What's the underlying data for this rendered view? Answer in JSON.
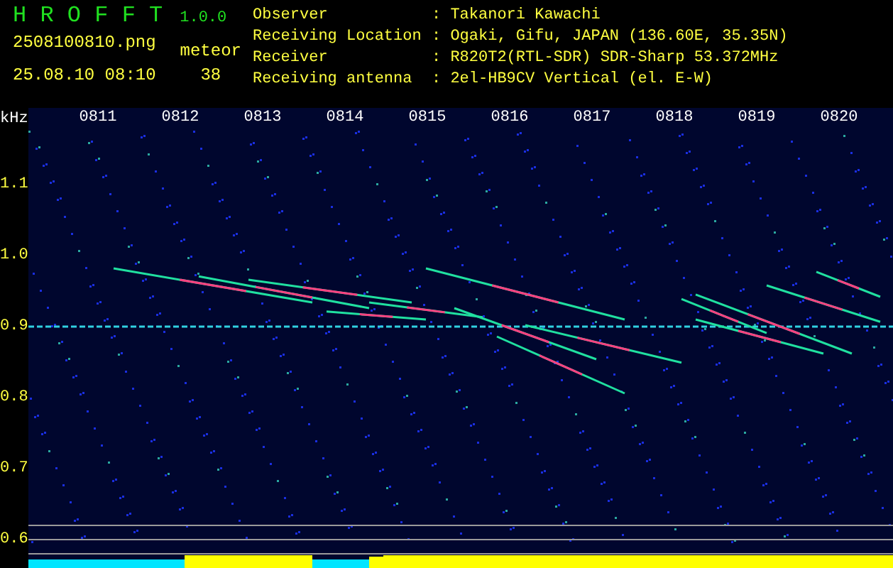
{
  "app": {
    "name": "H R O F F T",
    "version": "1.0.0",
    "filename": "2508100810.png",
    "datetime": "25.08.10 08:10",
    "count_label": "meteor",
    "count": "38"
  },
  "info": [
    {
      "label": "Observer",
      "value": ": Takanori Kawachi"
    },
    {
      "label": "Receiving Location",
      "value": ": Ogaki, Gifu, JAPAN (136.60E, 35.35N)"
    },
    {
      "label": "Receiver",
      "value": ": R820T2(RTL-SDR) SDR-Sharp 53.372MHz"
    },
    {
      "label": "Receiving antenna",
      "value": ": 2el-HB9CV Vertical (el. E-W)"
    }
  ],
  "plot": {
    "unit": "kHz",
    "time_labels": [
      "0811",
      "0812",
      "0813",
      "0814",
      "0815",
      "0816",
      "0817",
      "0818",
      "0819",
      "0820"
    ],
    "freq_labels": [
      "1.1",
      "1.0",
      "0.9",
      "0.8",
      "0.7",
      "0.6"
    ]
  }
}
